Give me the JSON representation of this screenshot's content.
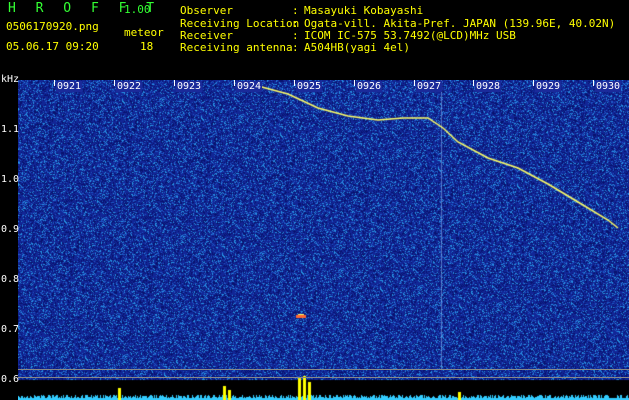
{
  "header": {
    "app_title": "H R O F F T",
    "version": "1.00",
    "file_name": "0506170920.png",
    "datetime": "05.06.17 09:20",
    "meteor_label": "meteor",
    "meteor_count": "18"
  },
  "info": {
    "observer_label": "Observer",
    "observer_value": "Masayuki Kobayashi",
    "location_label": "Receiving Location",
    "location_value": "Ogata-vill. Akita-Pref. JAPAN (139.96E, 40.02N)",
    "receiver_label": "Receiver",
    "receiver_value": "ICOM IC-575 53.7492(@LCD)MHz USB",
    "antenna_label": "Receiving antenna",
    "antenna_value": "A504HB(yagi 4el)",
    "colon": ":"
  },
  "axis": {
    "unit_label": "kHz",
    "y_labels": [
      "1.1",
      "1.0",
      "0.9",
      "0.8",
      "0.7",
      "0.6"
    ],
    "time_labels": [
      "0921",
      "0922",
      "0923",
      "0924",
      "0925",
      "0926",
      "0927",
      "0928",
      "0929",
      "0930"
    ]
  },
  "colors": {
    "background": "#000000",
    "header_green": "#33ff33",
    "header_yellow": "#ffff00",
    "noise_base": "#1a2a9a",
    "trace": "#ffff66"
  }
}
